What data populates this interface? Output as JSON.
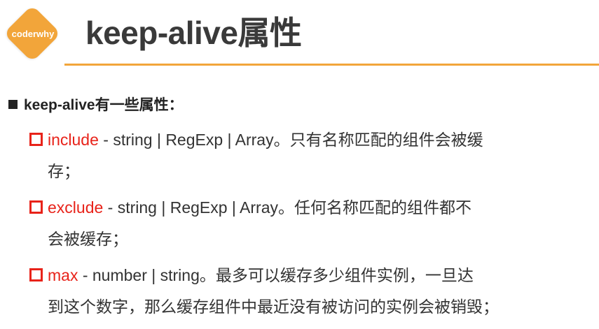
{
  "logo": {
    "text": "coderwhy",
    "color": "#f2a53a"
  },
  "title": "keep-alive属性",
  "heading": "keep-alive有一些属性：",
  "items": [
    {
      "name": "include",
      "desc": " - string | RegExp | Array。只有名称匹配的组件会被缓",
      "continuation": "存；"
    },
    {
      "name": "exclude",
      "desc": " - string | RegExp | Array。任何名称匹配的组件都不",
      "continuation": "会被缓存；"
    },
    {
      "name": "max",
      "desc": " - number | string。最多可以缓存多少组件实例，一旦达",
      "continuation": "到这个数字，那么缓存组件中最近没有被访问的实例会被销毁；"
    }
  ],
  "colors": {
    "accent": "#f2a53a",
    "option_name": "#e8231a",
    "text": "#333333"
  }
}
